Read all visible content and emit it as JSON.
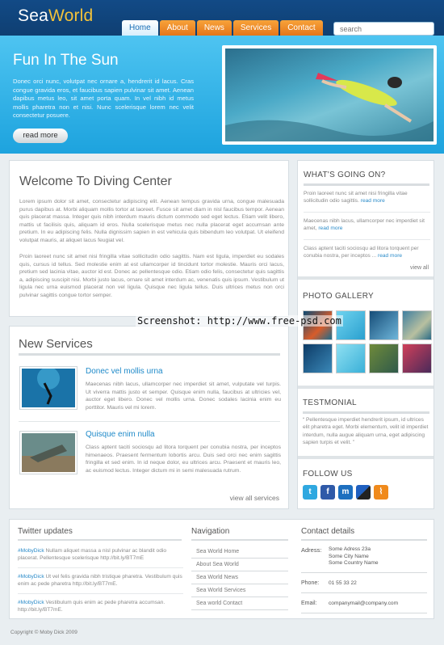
{
  "header": {
    "logo_sea": "Sea",
    "logo_world": "World",
    "nav": [
      "Home",
      "About",
      "News",
      "Services",
      "Contact"
    ],
    "search_placeholder": "search"
  },
  "hero": {
    "title": "Fun In The Sun",
    "text": "Donec orci nunc, volutpat nec ornare a, hendrerit id lacus. Cras congue gravida eros, et faucibus sapien pulvinar sit amet. Aenean dapibus metus leo, sit amet porta quam. In vel nibh id metus mollis pharetra non et nisi. Nunc scelerisque lorem nec velit consectetur posuere.",
    "read_more": "read more"
  },
  "welcome": {
    "title": "Welcome To Diving Center",
    "para1": "Lorem ipsum dolor sit amet, consectetur adipiscing elit. Aenean tempus gravida urna, congue malesuada purus dapibus at. Morbi aliquam mollis tortor at laoreet. Fusce sit amet diam in nisl faucibus tempor. Aenean quis placerat massa. Integer quis nibh interdum mauris dictum commodo sed eget lectus. Etiam velit libero, mattis ut facilisis quis, aliquam id eros. Nulla scelerisque metus nec nulla placerat eget accumsan ante pretium. In eu adipiscing felis. Nulla dignissim sapien in est vehicula quis bibendum leo volutpat. Ut eleifend volutpat mauris, at aliquet lacus feugiat vel.",
    "para2": "Proin laoreet nunc sit amet nisi fringilla vitae sollicitudin odio sagittis. Nam est ligula, imperdiet eu sodales quis, cursus id tellus. Sed molestie enim at est ullamcorper id tincidunt tortor molestie. Mauris orci lacus, pretium sed lacinia vitae, auctor id est. Donec ac pellentesque odio. Etiam odio felis, consectetur quis sagittis a, adipiscing suscipit nisi. Morbi justo lacus, ornare sit amet interdum ac, venenatis quis ipsum. Vestibulum ut ligula nec urna euismod placerat non vel ligula. Quisque nec ligula tellus. Duis ultrices metus non orci pulvinar sagittis congue tortor semper."
  },
  "services": {
    "title": "New Services",
    "items": [
      {
        "title": "Donec vel mollis urna",
        "text": "Maecenas nibh lacus, ullamcorper nec imperdiet sit amet, vulputate vel turpis. Ut viverra mattis justo et semper. Quisque enim nulla, faucibus at ultricies vel, auctor eget libero. Donec vel mollis urna. Donec sodales lacinia enim eu porttitor. Mauris vel mi lorem."
      },
      {
        "title": "Quisque enim nulla",
        "text": "Class aptent taciti sociosqu ad litora torquent per conubia nostra, per inceptos himenaeos. Praesent fermentum lobortis arcu. Duis sed orci nec enim sagittis fringilla et sed enim. In id neque dolor, eu ultrices arcu. Praesent et mauris leo, ac euismod lectus. Integer dictum mi in semi malesuada rutrum."
      }
    ],
    "view_all": "view all services"
  },
  "whats_going_on": {
    "title": "WHAT'S GOING ON?",
    "items": [
      {
        "text": "Proin laoreet nunc sit amet nisi fringilla vitae sollicitudin odio sagittis.",
        "link": "read more"
      },
      {
        "text": "Maecenas nibh lacus, ullamcorper nec imperdiet sit amet,",
        "link": "read more"
      },
      {
        "text": "Class aptent taciti sociosqu ad litora torquent per conubia nostra, per inceptos ...",
        "link": "read more"
      }
    ],
    "view_all": "view all"
  },
  "gallery": {
    "title": "PHOTO GALLERY"
  },
  "testimonial": {
    "title": "TESTMONIAL",
    "text": "“ Pellentesque imperdiet hendrerit ipsum, id ultrices elit pharetra eget. Morbi elementum, velit id imperdiet interdum, nulla augue aliquam urna, eget adipiscing sapien turpis et velit. ”"
  },
  "follow": {
    "title": "FOLLOW US"
  },
  "watermark": "Screenshot: http://www.free-psd.com",
  "twitter": {
    "title": "Twitter updates",
    "items": [
      {
        "user": "#MobyDick",
        "text": " Nullam aliquet massa a nisl pulvinar ac blandit odio placerat. Pellentesque scelerisque ",
        "link": "http://bit.ly/BT7mE"
      },
      {
        "user": "#MobyDick",
        "text": " Ut vel felis gravida nibh tristique pharetra. Vestibulum quis enim ac pede pharetra ",
        "link": "http://bit.ly/BT7mE."
      },
      {
        "user": "#MobyDick",
        "text": " Vestibulum quis enim ac pede pharetra accumsan. ",
        "link": "http://bit.ly/BT7mE."
      }
    ]
  },
  "navigation": {
    "title": "Navigation",
    "links": [
      "Sea World Home",
      "About Sea World",
      "Sea World News",
      "Sea World Services",
      "Sea world Contact"
    ]
  },
  "contact": {
    "title": "Contact details",
    "address_label": "Adress:",
    "address_lines": [
      "Some Adress 23a",
      "Some City Name",
      "Some Country Name"
    ],
    "phone_label": "Phone:",
    "phone": "01 55 33 22",
    "email_label": "Email:",
    "email": "companymail@company.com"
  },
  "copyright": "Copyright © Moby Dick 2009"
}
